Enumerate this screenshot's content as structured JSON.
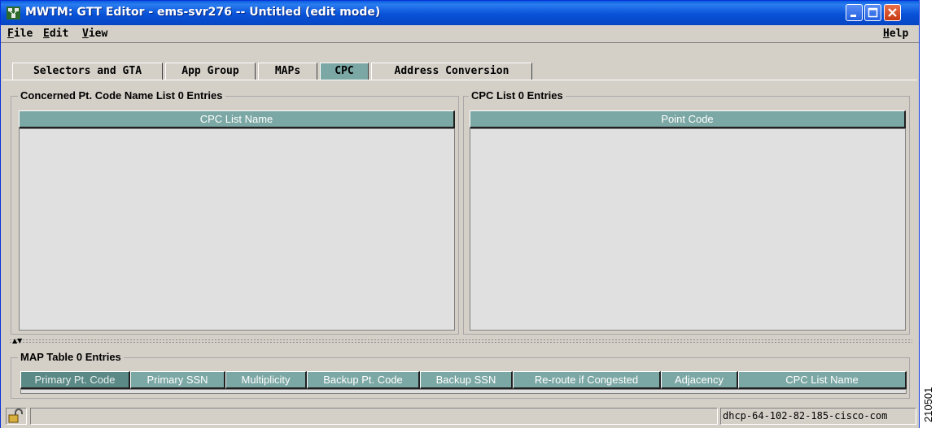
{
  "window": {
    "title": "MWTM:  GTT Editor - ems-svr276 -- Untitled (edit mode)",
    "controls": [
      "minimize-icon",
      "maximize-icon",
      "close-icon"
    ]
  },
  "menubar": {
    "file": {
      "accel": "F",
      "rest": "ile"
    },
    "edit": {
      "accel": "E",
      "rest": "dit"
    },
    "view": {
      "accel": "V",
      "rest": "iew"
    },
    "help": {
      "accel": "H",
      "rest": "elp"
    }
  },
  "tabs": [
    {
      "label": "Selectors and GTA",
      "active": false
    },
    {
      "label": "App Group",
      "active": false
    },
    {
      "label": "MAPs",
      "active": false
    },
    {
      "label": "CPC",
      "active": true
    },
    {
      "label": "Address Conversion",
      "active": false
    }
  ],
  "left_panel": {
    "title": "Concerned Pt. Code Name List  0 Entries",
    "column": "CPC List Name"
  },
  "right_panel": {
    "title": "CPC List  0 Entries",
    "column": "Point Code"
  },
  "map_table": {
    "title": "MAP Table  0 Entries",
    "columns": [
      "Primary Pt. Code",
      "Primary SSN",
      "Multiplicity",
      "Backup Pt. Code",
      "Backup SSN",
      "Re-route if Congested",
      "Adjacency",
      "CPC List Name"
    ]
  },
  "statusbar": {
    "icon": "lock-icon",
    "message": "",
    "host": "dhcp-64-102-82-185-cisco-com"
  },
  "figure_id": "210501",
  "colors": {
    "titlebar": "#0852d8",
    "header": "#7ba7a4",
    "panel_bg": "#d4d0c8",
    "list_bg": "#e0e0e0"
  }
}
